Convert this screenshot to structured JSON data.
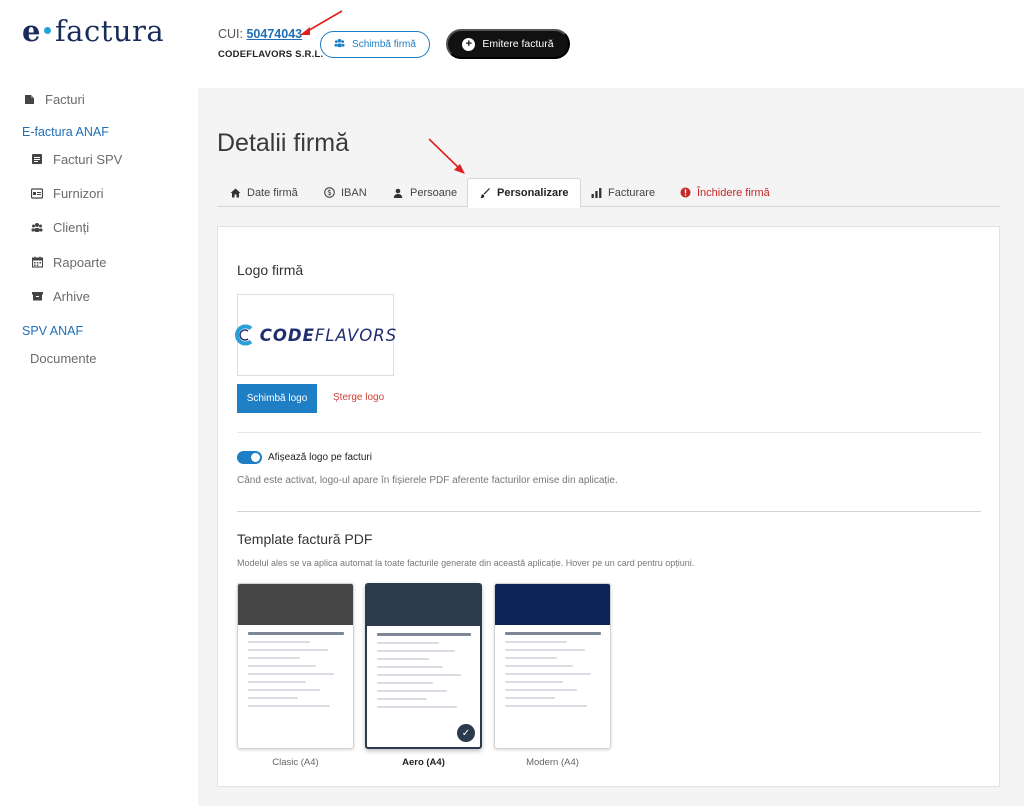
{
  "brand": {
    "e": "e",
    "name": "factura"
  },
  "sidebar": {
    "items": [
      {
        "label": "Facturi",
        "icon": "document-icon"
      },
      {
        "section": "E-factura ANAF"
      },
      {
        "label": "Facturi SPV",
        "icon": "invoice-icon"
      },
      {
        "label": "Furnizori",
        "icon": "card-icon"
      },
      {
        "label": "Clienți",
        "icon": "users-icon"
      },
      {
        "label": "Rapoarte",
        "icon": "calendar-icon"
      },
      {
        "label": "Arhive",
        "icon": "archive-icon"
      },
      {
        "section": "SPV ANAF"
      },
      {
        "label": "Documente",
        "icon": ""
      }
    ]
  },
  "header": {
    "cui_prefix": "CUI:",
    "cui_value": "50474043",
    "company": "CODEFLAVORS S.R.L.",
    "switch_label": "Schimbă firmă",
    "emit_label": "Emitere factură"
  },
  "page": {
    "title": "Detalii firmă",
    "tabs": [
      {
        "label": "Date firmă",
        "icon": "home-icon"
      },
      {
        "label": "IBAN",
        "icon": "dollar-icon"
      },
      {
        "label": "Persoane",
        "icon": "person-icon"
      },
      {
        "label": "Personalizare",
        "icon": "brush-icon",
        "active": true
      },
      {
        "label": "Facturare",
        "icon": "bar-chart-icon"
      },
      {
        "label": "Închidere firmă",
        "icon": "alert-icon",
        "danger": true
      }
    ]
  },
  "logo_section": {
    "title": "Logo firmă",
    "logo_text_bold": "CODE",
    "logo_text_light": "FLAVORS",
    "change_label": "Schimbă logo",
    "delete_label": "Șterge logo",
    "toggle_label": "Afișează logo pe facturi",
    "toggle_on": true,
    "toggle_help": "Când este activat, logo-ul apare în fișierele PDF aferente facturilor emise din aplicație."
  },
  "template_section": {
    "title": "Template factură PDF",
    "help": "Modelul ales se va aplica automat la toate facturile generate din această aplicație. Hover pe un card pentru opțiuni.",
    "templates": [
      {
        "label": "Clasic (A4)",
        "color": "#454545",
        "selected": false
      },
      {
        "label": "Aero (A4)",
        "color": "#2c3a4c",
        "selected": true
      },
      {
        "label": "Modern (A4)",
        "color": "#0d2458",
        "selected": false
      }
    ]
  },
  "colors": {
    "accent": "#1e7fc4",
    "danger": "#c62828",
    "annotation": "#e02020"
  }
}
